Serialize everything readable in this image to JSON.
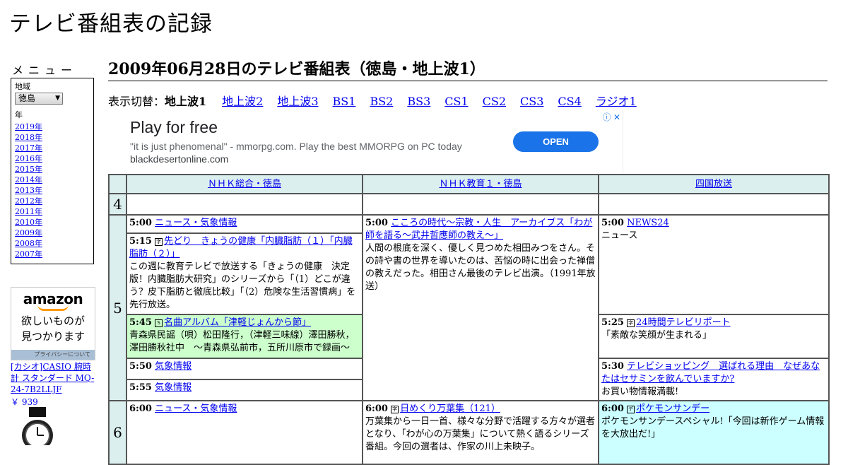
{
  "site": {
    "title": "テレビ番組表の記録"
  },
  "menu": {
    "heading": "メニュー",
    "region_label": "地域",
    "region_value": "徳島",
    "year_label": "年",
    "years": [
      "2019年",
      "2018年",
      "2017年",
      "2016年",
      "2015年",
      "2014年",
      "2013年",
      "2012年",
      "2011年",
      "2010年",
      "2009年",
      "2008年",
      "2007年"
    ]
  },
  "amazon_ad": {
    "logo": "amazon",
    "tagline_1": "欲しいものが",
    "tagline_2": "見つかります",
    "privacy": "プライバシーについて",
    "product_name": "[カシオ]CASIO 腕時計 スタンダード MQ-24-7B2LLJF",
    "product_price": "￥ 939"
  },
  "page": {
    "title": "2009年06月28日のテレビ番組表（徳島・地上波1）"
  },
  "switcher": {
    "label": "表示切替：",
    "current": "地上波1",
    "options": [
      "地上波2",
      "地上波3",
      "BS1",
      "BS2",
      "BS3",
      "CS1",
      "CS2",
      "CS3",
      "CS4",
      "ラジオ1"
    ]
  },
  "google_ad": {
    "headline": "Play for free",
    "body": "\"it is just phenomenal\" - mmorpg.com. Play the best MMORPG on PC today",
    "domain": "blackdesertonline.com",
    "cta": "OPEN",
    "choices": "ⓘ ✕"
  },
  "schedule": {
    "stations": [
      "ＮＨＫ総合・徳島",
      "ＮＨＫ教育１・徳島",
      "四国放送"
    ],
    "hours": [
      "4",
      "5",
      "6"
    ],
    "programs": {
      "nhk_0500": {
        "time": "5:00",
        "title": "ニュース・気象情報"
      },
      "nhk_0515": {
        "time": "5:15",
        "mark": "字",
        "title": "先どり　きょうの健康「内臓脂肪（１）「内臓脂肪（２）」",
        "desc": "この週に教育テレビで放送する「きょうの健康　決定版！内臓脂肪大研究」のシリーズから「（1）どこが違う？皮下脂肪と徹底比較」「（2）危険な生活習慣病」を先行放送。"
      },
      "nhk_0545": {
        "time": "5:45",
        "mark": "S",
        "title": "名曲アルバム「津軽じょんから節」",
        "desc": "青森県民謡（唄）松田隆行，（津軽三味線）澤田勝秋，澤田勝秋社中　～青森県弘前市，五所川原市で録画～"
      },
      "nhk_0550": {
        "time": "5:50",
        "title": "気象情報"
      },
      "nhk_0555": {
        "time": "5:55",
        "title": "気象情報"
      },
      "nhk_0600": {
        "time": "6:00",
        "title": "ニュース・気象情報"
      },
      "etv_0500": {
        "time": "5:00",
        "title": "こころの時代～宗教・人生　アーカイブス「わが師を語る～武井哲應師の教え～」",
        "desc": "人間の根底を深く、優しく見つめた相田みつをさん。その詩や書の世界を導いたのは、苦悩の時に出会った禅僧の教えだった。相田さん最後のテレビ出演。（1991年放送）"
      },
      "etv_0600": {
        "time": "6:00",
        "mark": "字",
        "title": "日めくり万葉集（121）",
        "desc": "万葉集から一日一首、様々な分野で活躍する方々が選者となり、「わが心の万葉集」について熱く語るシリーズ番組。今回の選者は、作家の川上未映子。"
      },
      "jrt_0500": {
        "time": "5:00",
        "title": "NEWS24",
        "desc": "ニュース"
      },
      "jrt_0525": {
        "time": "5:25",
        "mark": "字",
        "title": "24時間テレビリポート",
        "desc": "「素敵な笑顔が生まれる」"
      },
      "jrt_0530": {
        "time": "5:30",
        "title": "テレビショッピング　選ばれる理由　なぜあなたはセサミンを飲んでいますか?",
        "desc": "お買い物情報満載!"
      },
      "jrt_0600": {
        "time": "6:00",
        "mark": "デ",
        "title": "ポケモンサンデー",
        "desc": "ポケモンサンデースペシャル!「今回は新作ゲーム情報を大放出だ!」"
      }
    }
  }
}
